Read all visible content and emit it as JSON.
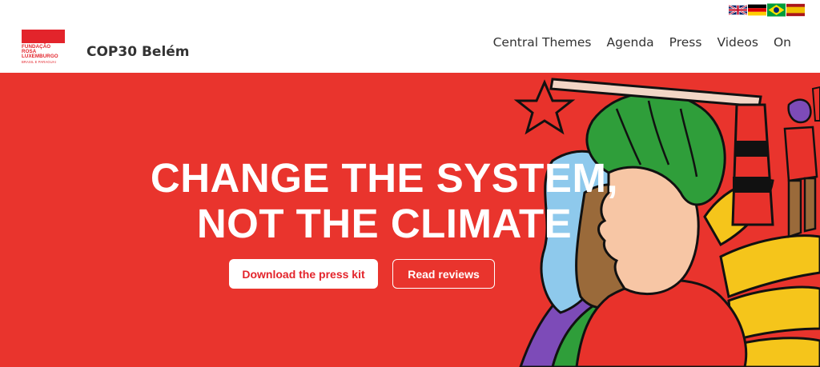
{
  "header": {
    "logo_lines": [
      "FUNDAÇÃO",
      "ROSA",
      "LUXEMBURGO",
      "BRASIL E PARAGUAI"
    ],
    "site_title": "COP30 Belém",
    "languages": [
      {
        "code": "en",
        "icon": "uk-flag-icon"
      },
      {
        "code": "de",
        "icon": "germany-flag-icon"
      },
      {
        "code": "pt",
        "icon": "brazil-flag-icon"
      },
      {
        "code": "es",
        "icon": "spain-flag-icon"
      }
    ],
    "nav": [
      "Central Themes",
      "Agenda",
      "Press",
      "Videos",
      "On"
    ]
  },
  "hero": {
    "headline_line1": "CHANGE THE SYSTEM,",
    "headline_line2": "NOT THE CLIMATE",
    "primary_button": "Download the press kit",
    "secondary_button": "Read reviews",
    "background_color": "#e9342d"
  }
}
